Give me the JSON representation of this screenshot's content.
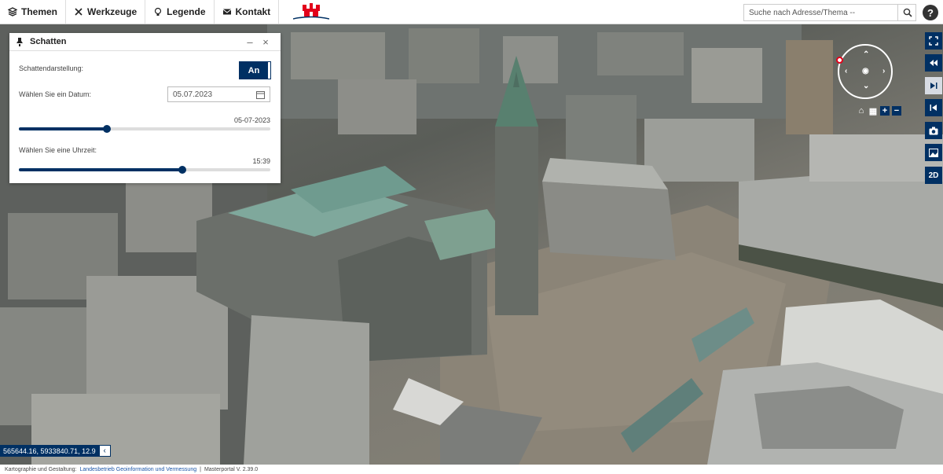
{
  "menu": {
    "items": [
      {
        "label": "Themen",
        "icon": "layers-icon"
      },
      {
        "label": "Werkzeuge",
        "icon": "tools-icon"
      },
      {
        "label": "Legende",
        "icon": "lightbulb-icon"
      },
      {
        "label": "Kontakt",
        "icon": "mail-icon"
      }
    ]
  },
  "search": {
    "placeholder": "Suche nach Adresse/Thema --"
  },
  "panel": {
    "title": "Schatten",
    "shadow_label": "Schattendarstellung:",
    "shadow_toggle": "An",
    "date_label": "Wählen Sie ein Datum:",
    "date_value": "05.07.2023",
    "date_slider_value": "05-07-2023",
    "date_slider_fraction": 0.35,
    "time_label": "Wählen Sie eine Uhrzeit:",
    "time_value": "15:39",
    "time_slider_fraction": 0.65
  },
  "controls": {
    "mode_label": "2D"
  },
  "coordinates": {
    "text": "565644.16, 5933840.71, 12.9"
  },
  "footer": {
    "credit_prefix": "Kartographie und Gestaltung:",
    "credit_link": "Landesbetrieb Geoinformation und Vermessung",
    "version": "Masterportal V. 2.39.0"
  }
}
